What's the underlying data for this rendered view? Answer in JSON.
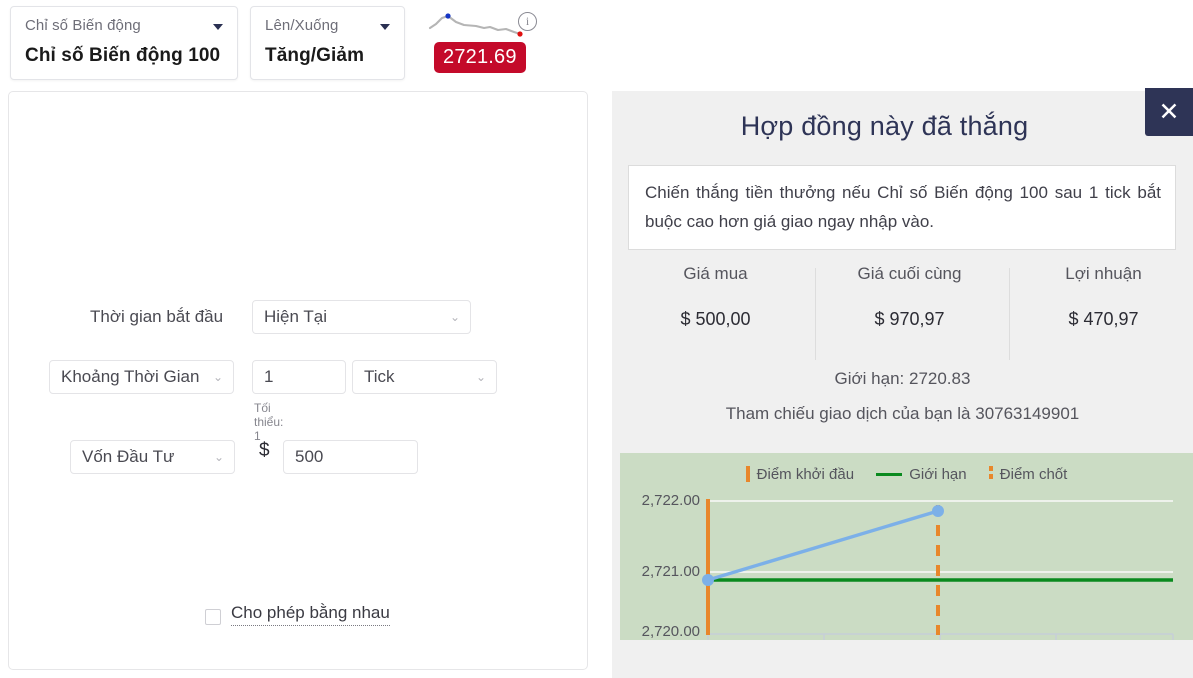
{
  "topbar": {
    "market": {
      "sublabel": "Chỉ số Biến động",
      "value": "Chỉ số Biến động 100",
      "caret_icon": "chevron-down-icon"
    },
    "trade_type": {
      "sublabel": "Lên/Xuống",
      "value": "Tăng/Giảm",
      "caret_icon": "chevron-down-icon"
    },
    "price": "2721.69",
    "price_color": "#c40a2a",
    "info_icon": "info-icon",
    "sparkline_icon": "sparkline-icon"
  },
  "form": {
    "start_time_label": "Thời gian bắt đầu",
    "start_time_value": "Hiện Tại",
    "duration_mode": "Khoảng Thời Gian",
    "duration_value": "1",
    "duration_unit": "Tick",
    "duration_hint": "Tối thiểu: 1",
    "stake_mode": "Vốn Đầu Tư",
    "currency_symbol": "$",
    "stake_value": "500",
    "allow_equals_label": "Cho phép bằng nhau",
    "chevron_icon": "chevron-down-small-icon"
  },
  "dialog": {
    "title": "Hợp đồng này đã thắng",
    "close_icon": "close-icon",
    "description": "Chiến thắng tiền thưởng nếu Chỉ số Biến động 100 sau 1 tick bắt buộc cao hơn giá giao ngay nhập vào.",
    "stats": [
      {
        "header": "Giá mua",
        "value": "$ 500,00"
      },
      {
        "header": "Giá cuối cùng",
        "value": "$ 970,97"
      },
      {
        "header": "Lợi nhuận",
        "value": "$ 470,97"
      }
    ],
    "barrier_text": "Giới hạn: 2720.83",
    "reference_text": "Tham chiếu giao dịch của bạn là 30763149901"
  },
  "chart_data": {
    "type": "line",
    "title": "",
    "xlabel": "",
    "ylabel": "",
    "ylim": [
      2719.5,
      2722.4
    ],
    "yticks": [
      "2,720.00",
      "2,721.00",
      "2,722.00"
    ],
    "ytick_values": [
      2720.0,
      2721.0,
      2722.0
    ],
    "grid": true,
    "legend_position": "top-center",
    "background_color": "#cbdcc4",
    "legend": [
      {
        "label": "Điểm khởi đầu",
        "swatch": "solid-bar",
        "color": "#e8872b"
      },
      {
        "label": "Giới hạn",
        "swatch": "line",
        "color": "#0a8a1e"
      },
      {
        "label": "Điểm chốt",
        "swatch": "dashed-bar",
        "color": "#e8872b"
      }
    ],
    "series": [
      {
        "name": "spot",
        "color": "#7cb0e8",
        "x": [
          0,
          1
        ],
        "values": [
          2720.83,
          2721.87
        ],
        "markers": true
      }
    ],
    "barrier_line": {
      "name": "Giới hạn",
      "value": 2720.83,
      "color": "#0a8a1e"
    },
    "entry_marker": {
      "name": "Điểm khởi đầu",
      "x": 0,
      "color": "#e8872b",
      "style": "solid"
    },
    "exit_marker": {
      "name": "Điểm chốt",
      "x": 1,
      "color": "#e8872b",
      "style": "dashed"
    }
  }
}
